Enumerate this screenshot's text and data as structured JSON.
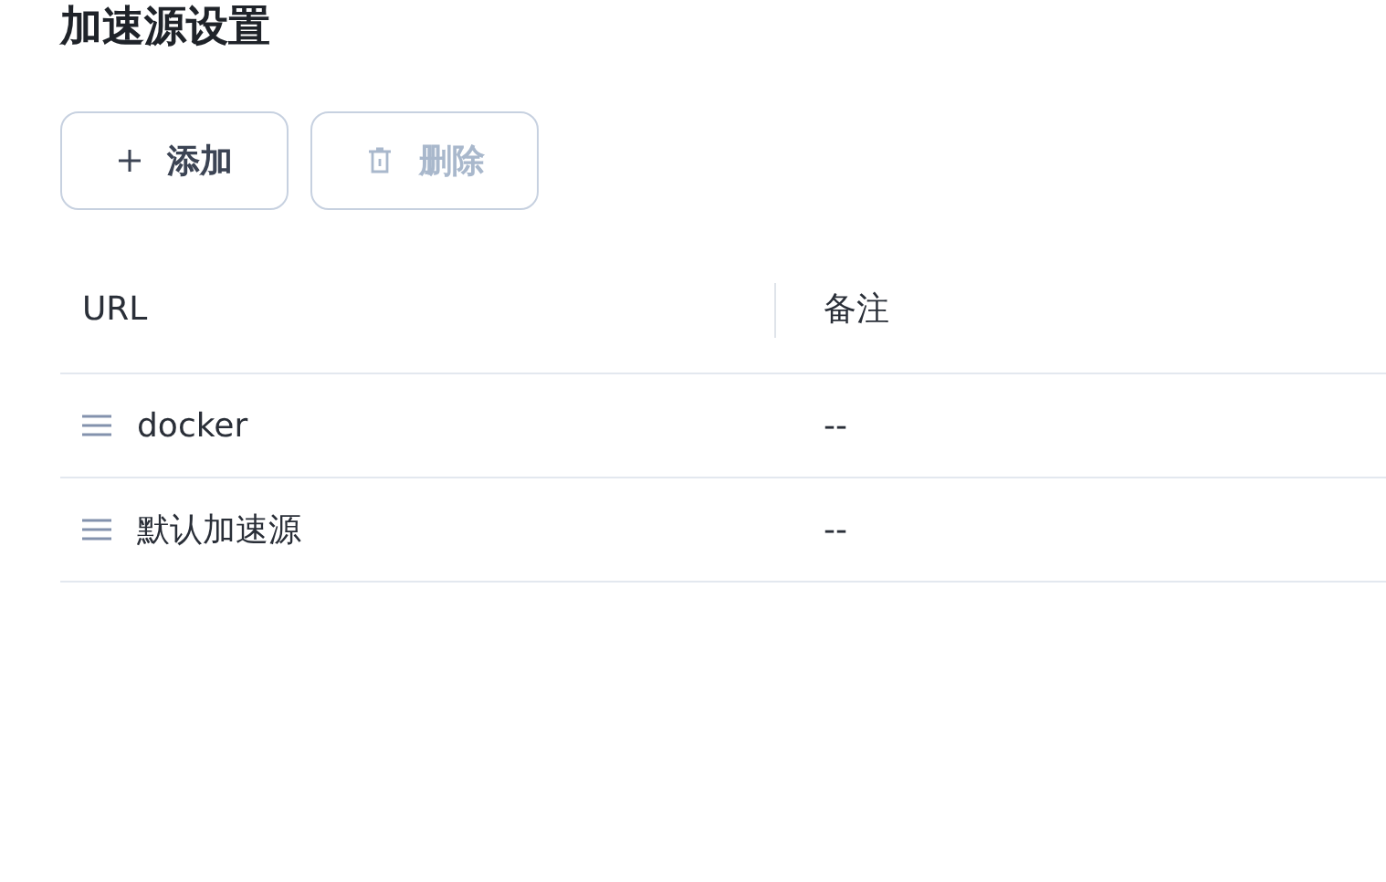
{
  "title": "加速源设置",
  "buttons": [
    {
      "label": "添加",
      "kind": "add",
      "disabled": false
    },
    {
      "label": "删除",
      "kind": "delete",
      "disabled": true
    }
  ],
  "table": {
    "columns": [
      "URL",
      "备注"
    ],
    "rows": [
      {
        "url": "docker",
        "note": "--"
      },
      {
        "url": "默认加速源",
        "note": "--"
      }
    ]
  }
}
